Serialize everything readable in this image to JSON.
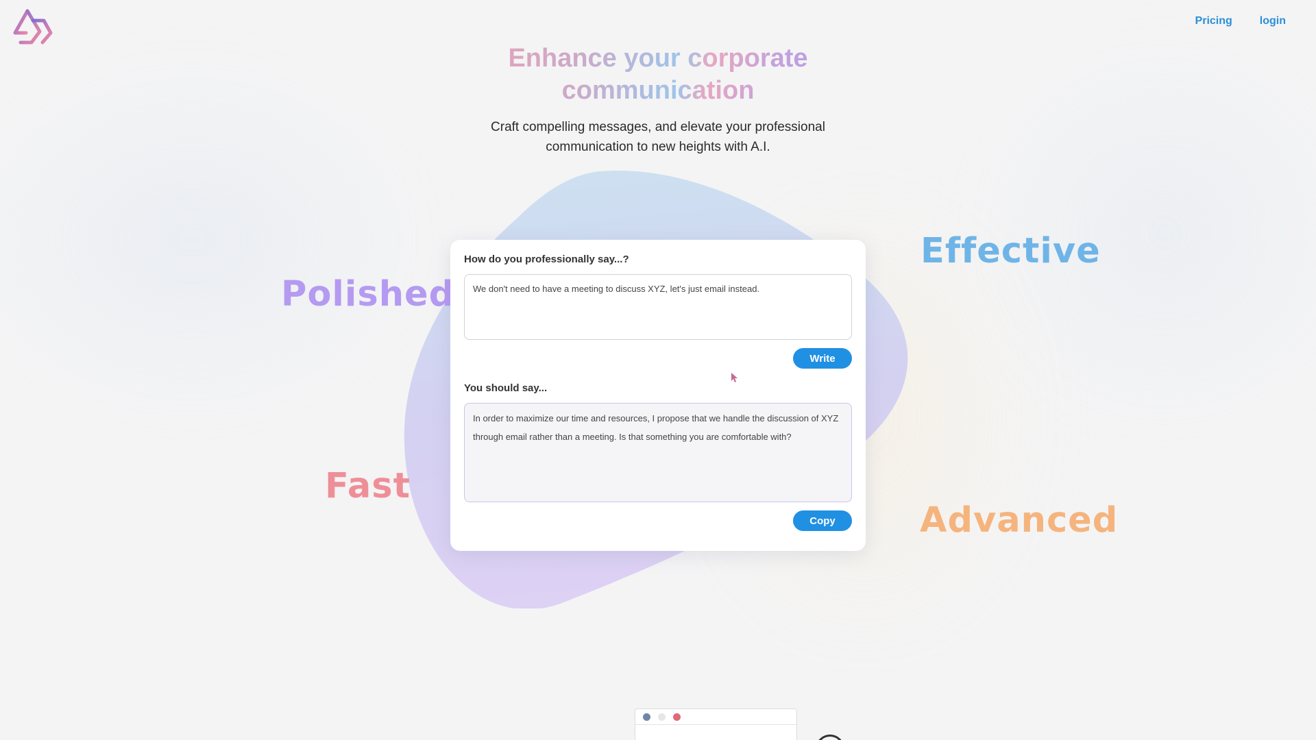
{
  "header": {
    "logo_icon": "triangle-logo-icon",
    "nav": {
      "pricing_label": "Pricing",
      "login_label": "login"
    }
  },
  "hero": {
    "title": "Enhance your corporate communication",
    "subtitle": "Craft compelling messages, and elevate your professional communication to new heights with A.I."
  },
  "features": {
    "polished": "Polished",
    "effective": "Effective",
    "fast": "Fast",
    "advanced": "Advanced"
  },
  "composer": {
    "input_label": "How do you professionally say...?",
    "input_value": "We don't need to have a meeting to discuss XYZ, let's just email instead.",
    "write_label": "Write",
    "output_label": "You should say...",
    "output_value": "In order to maximize our time and resources, I propose that we handle the discussion of XYZ through email rather than a meeting. Is that something you are comfortable with?",
    "copy_label": "Copy"
  },
  "colors": {
    "accent": "#2090e3",
    "polished": "#b59af1",
    "effective": "#6fb4e7",
    "fast": "#ee8f98",
    "advanced": "#f5b47d"
  }
}
